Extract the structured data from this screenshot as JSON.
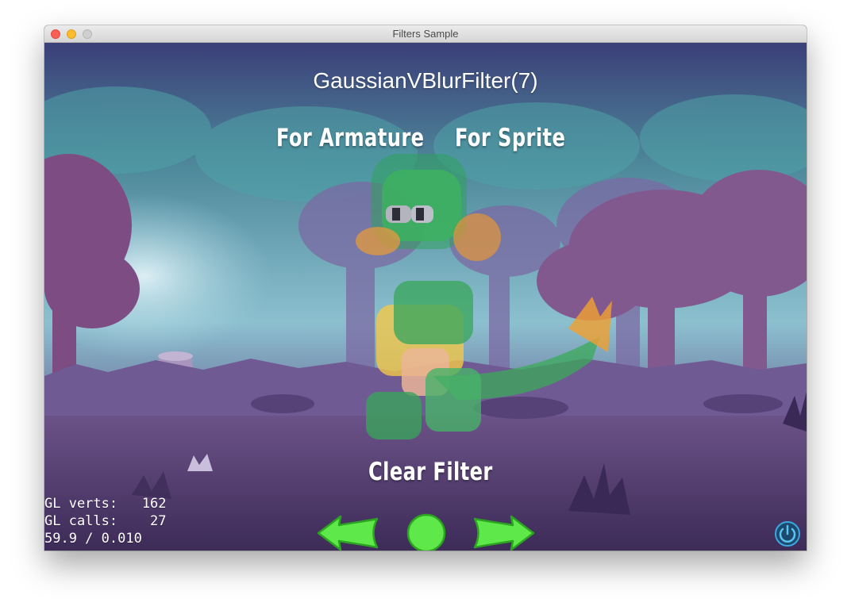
{
  "window": {
    "title": "Filters Sample"
  },
  "scene": {
    "filter_title": "GaussianVBlurFilter(7)",
    "buttons": {
      "armature": "For Armature",
      "sprite": "For Sprite",
      "clear": "Clear Filter"
    }
  },
  "stats": {
    "verts_line": "GL verts:   162",
    "calls_line": "GL calls:    27",
    "fps_line": "59.9 / 0.010"
  },
  "icons": {
    "prev": "left-arrow-icon",
    "restart": "circle-icon",
    "next": "right-arrow-icon",
    "close": "power-icon"
  },
  "colors": {
    "nav_green": "#5ee84a",
    "nav_outline": "#2ba51f",
    "power_blue": "#3aa8e0"
  }
}
